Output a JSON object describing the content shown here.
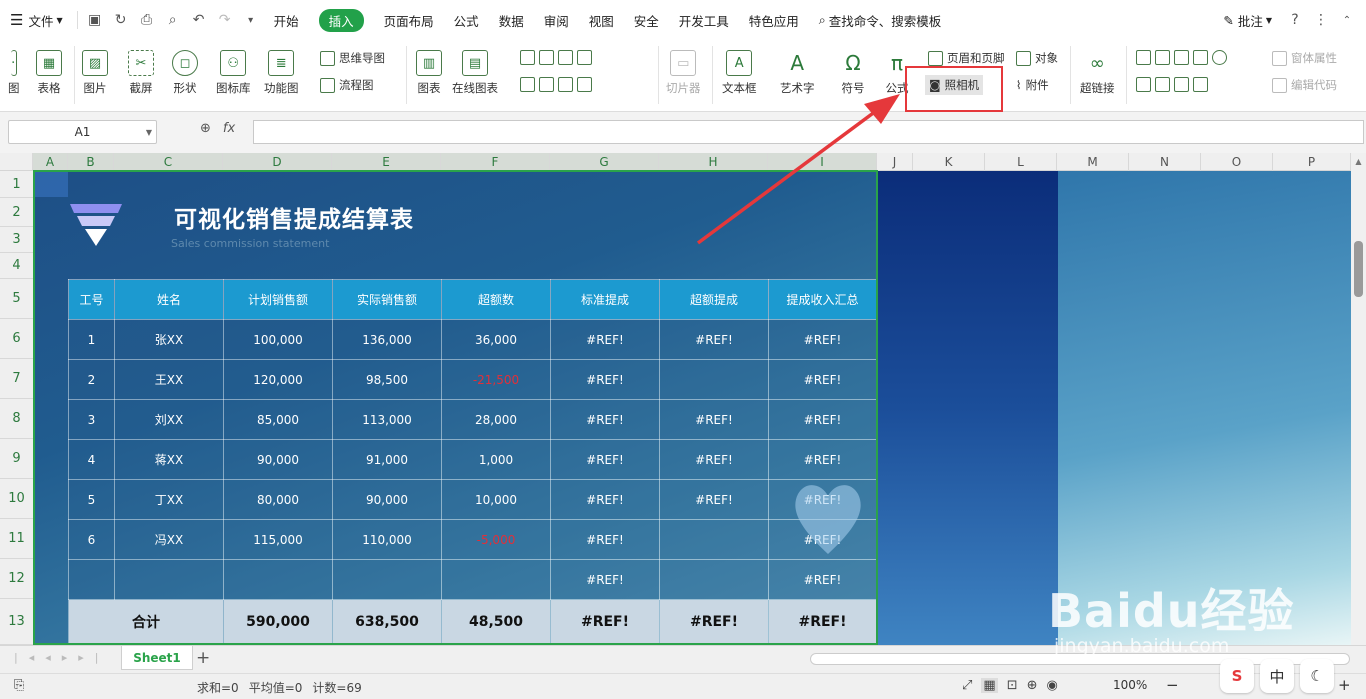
{
  "menubar": {
    "file_label": "文件",
    "tabs": [
      {
        "label": "开始"
      },
      {
        "label": "插入",
        "active": true
      },
      {
        "label": "页面布局"
      },
      {
        "label": "公式"
      },
      {
        "label": "数据"
      },
      {
        "label": "审阅"
      },
      {
        "label": "视图"
      },
      {
        "label": "安全"
      },
      {
        "label": "开发工具"
      },
      {
        "label": "特色应用"
      }
    ],
    "search_label": "查找命令、搜索模板",
    "annotate_label": "批注",
    "help_icon": "question-icon",
    "accent": "#22a14a"
  },
  "ribbon": {
    "left_clip_label": "图",
    "table": "表格",
    "picture": "图片",
    "screenshot": "截屏",
    "shape": "形状",
    "icon_lib": "图标库",
    "feature_chart": "功能图",
    "mindmap": "思维导图",
    "flowchart": "流程图",
    "chart": "图表",
    "online_chart": "在线图表",
    "slicer": "切片器",
    "textbox": "文本框",
    "wordart": "艺术字",
    "symbol": "符号",
    "formula": "公式",
    "header_footer": "页眉和页脚",
    "camera": "照相机",
    "object": "对象",
    "attachment": "附件",
    "hyperlink": "超链接",
    "form_props": "窗体属性",
    "edit_code": "编辑代码"
  },
  "formula_bar": {
    "name_box": "A1",
    "fx_label": "fx"
  },
  "columns": [
    "A",
    "B",
    "C",
    "D",
    "E",
    "F",
    "G",
    "H",
    "I",
    "J",
    "K",
    "L",
    "M",
    "N",
    "O",
    "P"
  ],
  "rows": [
    "1",
    "2",
    "3",
    "4",
    "5",
    "6",
    "7",
    "8",
    "9",
    "10",
    "11",
    "12",
    "13"
  ],
  "sheet": {
    "title": "可视化销售提成结算表",
    "subtitle": "Sales commission statement",
    "headers": [
      "工号",
      "姓名",
      "计划销售额",
      "实际销售额",
      "超额数",
      "标准提成",
      "超额提成",
      "提成收入汇总"
    ],
    "data_rows": [
      [
        "1",
        "张XX",
        "100,000",
        "136,000",
        "36,000",
        "#REF!",
        "#REF!",
        "#REF!"
      ],
      [
        "2",
        "王XX",
        "120,000",
        "98,500",
        "-21,500",
        "#REF!",
        "",
        "#REF!"
      ],
      [
        "3",
        "刘XX",
        "85,000",
        "113,000",
        "28,000",
        "#REF!",
        "#REF!",
        "#REF!"
      ],
      [
        "4",
        "蒋XX",
        "90,000",
        "91,000",
        "1,000",
        "#REF!",
        "#REF!",
        "#REF!"
      ],
      [
        "5",
        "丁XX",
        "80,000",
        "90,000",
        "10,000",
        "#REF!",
        "#REF!",
        "#REF!"
      ],
      [
        "6",
        "冯XX",
        "115,000",
        "110,000",
        "-5,000",
        "#REF!",
        "",
        "#REF!"
      ],
      [
        "",
        "",
        "",
        "",
        "",
        "#REF!",
        "",
        "#REF!"
      ]
    ],
    "total_row": [
      "合计",
      "590,000",
      "638,500",
      "48,500",
      "#REF!",
      "#REF!",
      "#REF!"
    ],
    "negative_color": "#e0303a",
    "header_color": "#1c9ad0"
  },
  "tabs": {
    "sheet_name": "Sheet1",
    "add_label": "+"
  },
  "status": {
    "sum": "求和=0",
    "avg": "平均值=0",
    "count": "计数=69",
    "zoom": "100%"
  },
  "watermark": {
    "main": "Baidu经验",
    "url": "jingyan.baidu.com"
  },
  "tray": {
    "ime": "中"
  },
  "highlight_color": "#e5383b"
}
